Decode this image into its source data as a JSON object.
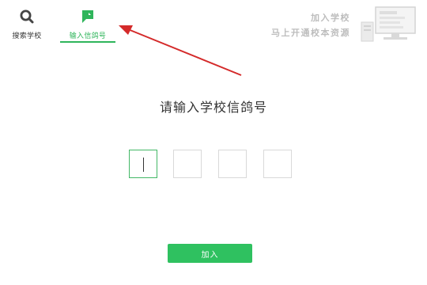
{
  "tabs": {
    "search": {
      "label": "搜索学校",
      "icon": "search-icon"
    },
    "code": {
      "label": "输入信鸽号",
      "icon": "flag-icon",
      "selected": true
    }
  },
  "banner": {
    "line1": "加入学校",
    "line2": "马上开通校本资源",
    "illustration": "desk-monitor-illustration"
  },
  "main": {
    "heading": "请输入学校信鸽号",
    "code_inputs": [
      "",
      "",
      "",
      ""
    ],
    "join_label": "加入"
  },
  "colors": {
    "accent": "#2fb55b",
    "button": "#2fc160",
    "annotation_arrow": "#d42a2a"
  }
}
